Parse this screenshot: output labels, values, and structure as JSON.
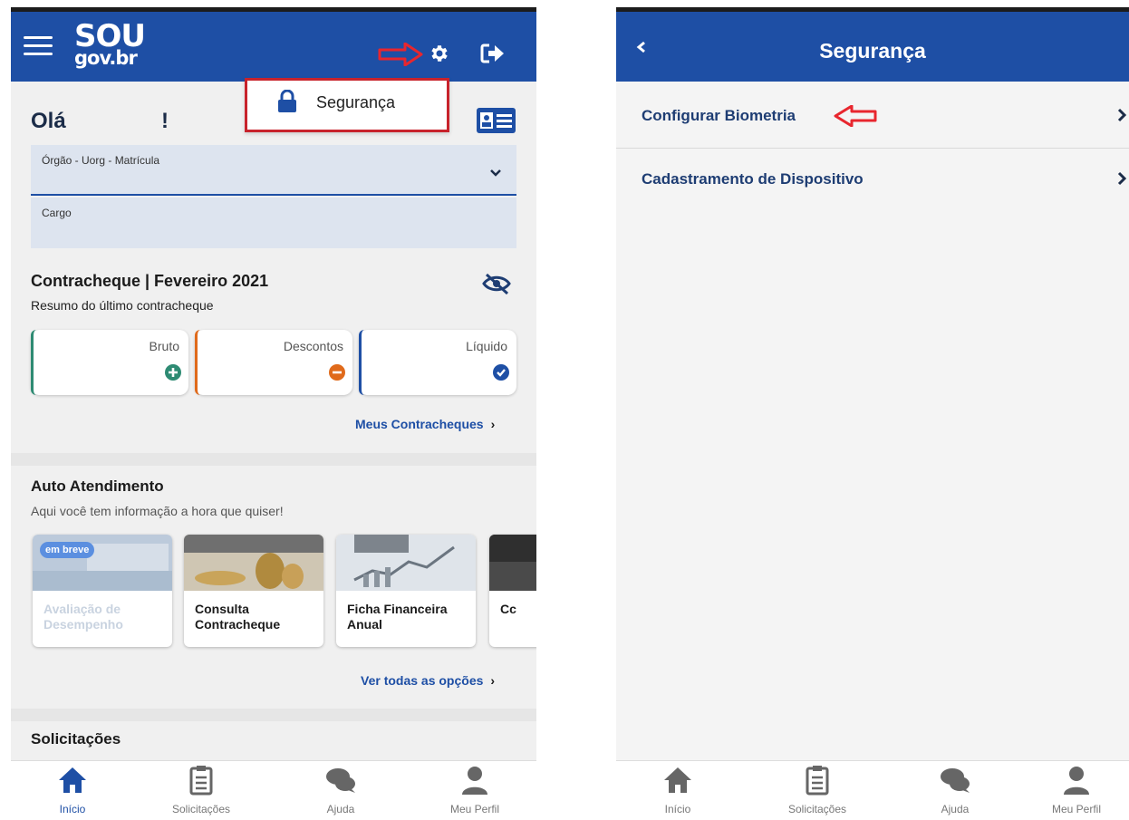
{
  "left_screen": {
    "header": {
      "logo_top": "SOU",
      "logo_bottom": "gov.br"
    },
    "popup": {
      "label": "Segurança"
    },
    "greeting": {
      "hello": "Olá",
      "exclamation": "!"
    },
    "fields": [
      {
        "label": "Órgão - Uorg - Matrícula"
      },
      {
        "label": "Cargo"
      }
    ],
    "paycheck": {
      "title": "Contracheque | Fevereiro 2021",
      "subtitle": "Resumo do último contracheque",
      "cards": [
        {
          "label": "Bruto",
          "color": "#2e8b73",
          "icon": "plus-circle-icon"
        },
        {
          "label": "Descontos",
          "color": "#e06a1b",
          "icon": "minus-circle-icon"
        },
        {
          "label": "Líquido",
          "color": "#1e4fa5",
          "icon": "check-circle-icon"
        }
      ],
      "link": "Meus Contracheques"
    },
    "self_service": {
      "title": "Auto Atendimento",
      "subtitle": "Aqui você tem informação a hora que quiser!",
      "tiles": [
        {
          "title_1": "Avaliação de",
          "title_2": "Desempenho",
          "badge": "em breve"
        },
        {
          "title_1": "Consulta",
          "title_2": "Contracheque"
        },
        {
          "title_1": "Ficha Financeira",
          "title_2": "Anual"
        },
        {
          "title_1": "Cc",
          "title_2": ""
        }
      ],
      "link": "Ver todas as opções"
    },
    "requests": {
      "title": "Solicitações"
    }
  },
  "right_screen": {
    "header": {
      "title": "Segurança"
    },
    "menu": [
      {
        "label": "Configurar Biometria"
      },
      {
        "label": "Cadastramento de Dispositivo"
      }
    ]
  },
  "bottom_nav": [
    {
      "label": "Início",
      "icon": "home-icon"
    },
    {
      "label": "Solicitações",
      "icon": "clipboard-icon"
    },
    {
      "label": "Ajuda",
      "icon": "chat-icon"
    },
    {
      "label": "Meu Perfil",
      "icon": "user-icon"
    }
  ],
  "colors": {
    "primary": "#1e4fa5",
    "annotation_red": "#c8232c",
    "disabled_text": "#c9d3e0"
  }
}
